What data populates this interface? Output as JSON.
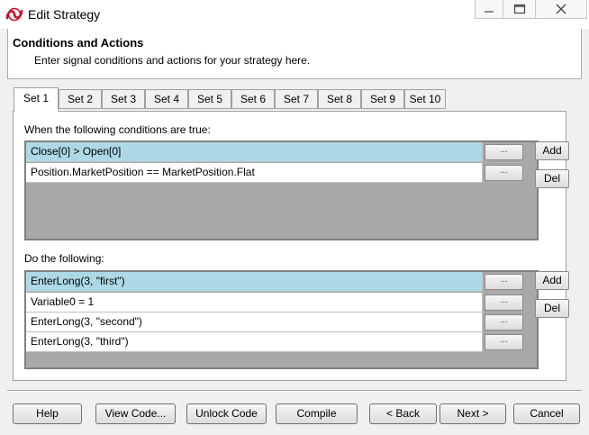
{
  "window": {
    "title": "Edit Strategy",
    "icon": "ninjatrader-logo-icon",
    "controls": {
      "minimize": "minimize-icon",
      "maximize": "maximize-icon",
      "close": "close-icon"
    }
  },
  "header": {
    "title": "Conditions and Actions",
    "subtitle": "Enter signal conditions and actions for your strategy here."
  },
  "tabs": [
    {
      "label": "Set 1",
      "active": true
    },
    {
      "label": "Set 2"
    },
    {
      "label": "Set 3"
    },
    {
      "label": "Set 4"
    },
    {
      "label": "Set 5"
    },
    {
      "label": "Set 6"
    },
    {
      "label": "Set 7"
    },
    {
      "label": "Set 8"
    },
    {
      "label": "Set 9"
    },
    {
      "label": "Set 10"
    }
  ],
  "conditions": {
    "label": "When the following conditions are true:",
    "rows": [
      {
        "text": "Close[0] > Open[0]",
        "selected": true,
        "button": "..."
      },
      {
        "text": "Position.MarketPosition == MarketPosition.Flat",
        "selected": false,
        "button": "..."
      }
    ],
    "add_label": "Add",
    "del_label": "Del"
  },
  "actions": {
    "label": "Do the following:",
    "rows": [
      {
        "text": "EnterLong(3, \"first\")",
        "selected": true,
        "button": "..."
      },
      {
        "text": "Variable0 = 1",
        "selected": false,
        "button": "..."
      },
      {
        "text": "EnterLong(3, \"second\")",
        "selected": false,
        "button": "..."
      },
      {
        "text": "EnterLong(3, \"third\")",
        "selected": false,
        "button": "..."
      }
    ],
    "add_label": "Add",
    "del_label": "Del"
  },
  "footer": {
    "help": "Help",
    "view_code": "View Code...",
    "unlock_code": "Unlock Code",
    "compile": "Compile",
    "back": "< Back",
    "next": "Next >",
    "cancel": "Cancel"
  },
  "colors": {
    "selected_row": "#add8e6",
    "list_background": "#a9a9a9",
    "logo_red": "#c8102e"
  }
}
